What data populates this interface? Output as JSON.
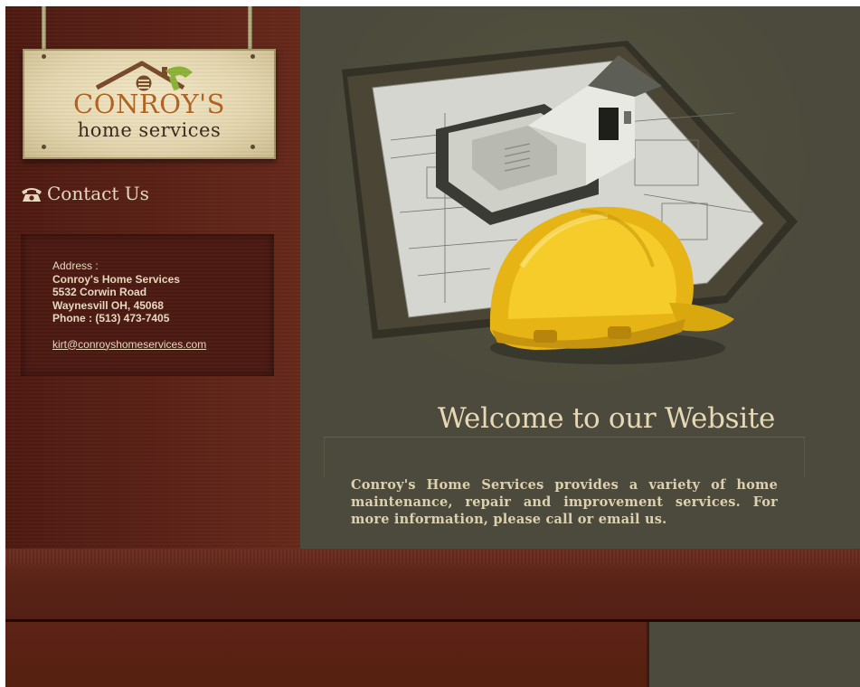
{
  "brand": {
    "line1": "CONROY'S",
    "line2": "home services",
    "colors": {
      "orange": "#b4641e",
      "green": "#8db33a",
      "sign": "#e4d6ae"
    }
  },
  "contact": {
    "heading": "Contact Us",
    "icon": "phone-icon",
    "address_label": "Address :",
    "company": "Conroy's Home Services",
    "street": "5532 Corwin Road",
    "city": "Waynesvill OH, 45068",
    "phone": "Phone : (513) 473-7405",
    "email": "kirt@conroyshomeservices.com"
  },
  "hero": {
    "illustration": "house-blueprint-hardhat",
    "welcome": "Welcome to our Website",
    "intro": "Conroy's Home Services provides a variety of home maintenance, repair and improvement services. For more information, please call or email us."
  },
  "theme": {
    "sidebar": "#5c2317",
    "hero": "#4b4a3c",
    "text": "#e6d8b5"
  }
}
